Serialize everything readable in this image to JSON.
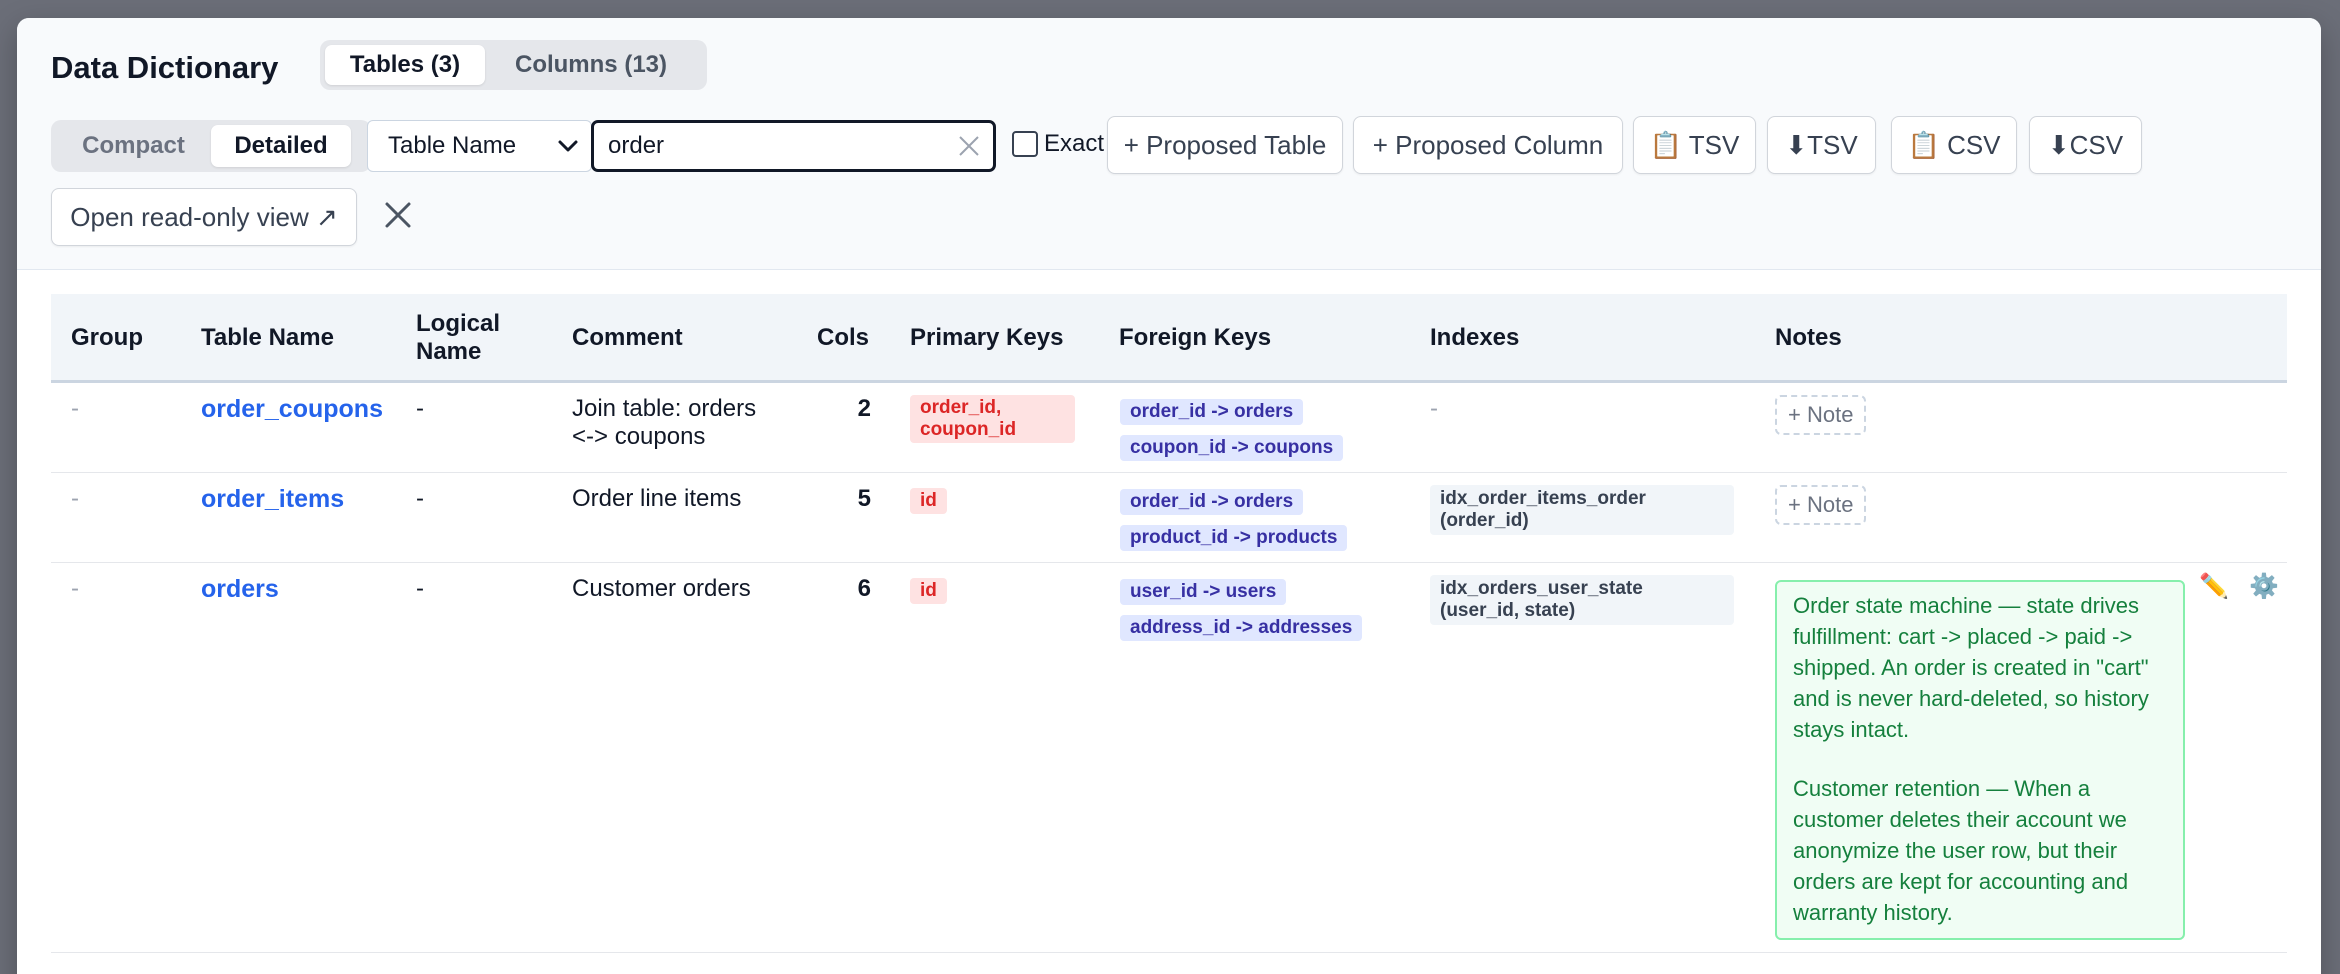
{
  "title": "Data Dictionary",
  "tabs": [
    "Tables (3)",
    "Columns (13)"
  ],
  "view_modes": [
    "Compact",
    "Detailed"
  ],
  "filter": {
    "field": "Table Name",
    "query": "order",
    "exact_label": "Exact"
  },
  "actions": {
    "proposed_table": "+ Proposed Table",
    "proposed_column": "+ Proposed Column",
    "copy_tsv": "📋 TSV",
    "download_tsv": "⬇TSV",
    "copy_csv": "📋 CSV",
    "download_csv": "⬇CSV",
    "readonly": "Open read-only view ↗"
  },
  "columns": [
    "Group",
    "Table Name",
    "Logical Name",
    "Comment",
    "Cols",
    "Primary Keys",
    "Foreign Keys",
    "Indexes",
    "Notes"
  ],
  "rows": [
    {
      "group": "-",
      "table": "order_coupons",
      "logical": "-",
      "comment": "Join table: orders <-> coupons",
      "cols": "2",
      "pk": "order_id, coupon_id",
      "fks": [
        "order_id -> orders",
        "coupon_id -> coupons"
      ],
      "indexes": "-",
      "note_button": "+ Note"
    },
    {
      "group": "-",
      "table": "order_items",
      "logical": "-",
      "comment": "Order line items",
      "cols": "5",
      "pk": "id",
      "fks": [
        "order_id -> orders",
        "product_id -> products"
      ],
      "indexes": "idx_order_items_order (order_id)",
      "note_button": "+ Note"
    },
    {
      "group": "-",
      "table": "orders",
      "logical": "-",
      "comment": "Customer orders",
      "cols": "6",
      "pk": "id",
      "fks": [
        "user_id -> users",
        "address_id -> addresses"
      ],
      "indexes": "idx_orders_user_state (user_id, state)",
      "notes": [
        "Order state machine — state drives fulfillment: cart -> placed -> paid -> shipped. An order is created in \"cart\" and is never hard-deleted, so history stays intact.",
        "Customer retention — When a customer deletes their account we anonymize the user row, but their orders are kept for accounting and warranty history."
      ],
      "edit_icon": "✏️",
      "settings_icon": "⚙️"
    }
  ]
}
